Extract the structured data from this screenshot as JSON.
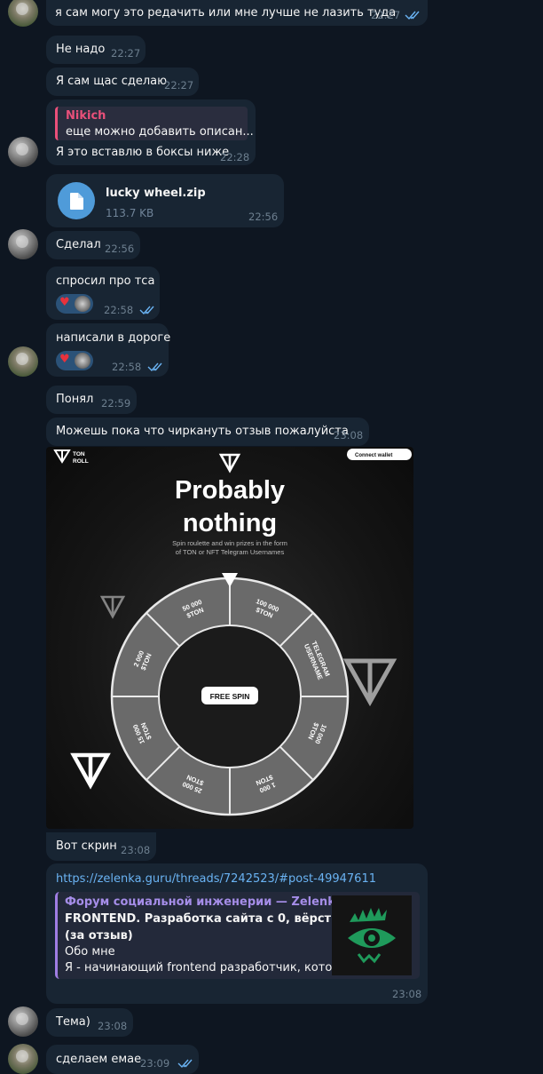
{
  "messages": [
    {
      "text": "я сам могу это редачить или мне лучше не лазить туда",
      "time": "22:27"
    },
    {
      "text": "Не надо",
      "time": "22:27"
    },
    {
      "text": "Я сам щас сделаю",
      "time": "22:27"
    },
    {
      "reply_name": "Nikich",
      "reply_text": "еще можно добавить описан...",
      "text": "Я это вставлю в боксы ниже",
      "time": "22:28"
    },
    {
      "file_name": "lucky wheel.zip",
      "file_size": "113.7 KB",
      "time": "22:56"
    },
    {
      "text": "Сделал",
      "time": "22:56"
    },
    {
      "text": "спросил про тса",
      "time": "22:58",
      "reaction": "♥"
    },
    {
      "text": "написали в дороге",
      "time": "22:58",
      "reaction": "♥"
    },
    {
      "text": "Понял",
      "time": "22:59"
    },
    {
      "text": "Можешь пока что чиркануть отзыв пожалуйста",
      "time": "23:08"
    },
    {
      "text": "Вот скрин",
      "time": "23:08"
    },
    {
      "link": "https://zelenka.guru/threads/7242523/#post-49947611",
      "preview_site": "Форум социальной инженерии — Zelenka....",
      "preview_title_1": "FRONTEND. Разработка сайта с 0, вёрстка.",
      "preview_title_2": "(за отзыв)",
      "preview_line_1": "Обо мне",
      "preview_line_2": "Я - начинающий frontend разработчик, кото...",
      "time": "23:08"
    },
    {
      "text": "Тема)",
      "time": "23:08"
    },
    {
      "text": "сделаем емае",
      "time": "23:09"
    }
  ],
  "screenshot": {
    "brand_line1": "TON",
    "brand_line2": "ROLL",
    "connect_label": "Connect wallet",
    "headline_1": "Probably",
    "headline_2": "nothing",
    "subtitle_1": "Spin roulette and win prizes in the form",
    "subtitle_2": "of TON or NFT Telegram Usernames",
    "center_button": "FREE SPIN",
    "sectors": [
      {
        "l1": "100 000",
        "l2": "$TON"
      },
      {
        "l1": "TELEGRAM",
        "l2": "USERNAME"
      },
      {
        "l1": "10 000",
        "l2": "$TON"
      },
      {
        "l1": "1 000",
        "l2": "$TON"
      },
      {
        "l1": "25 000",
        "l2": "$TON"
      },
      {
        "l1": "15 000",
        "l2": "$TON"
      },
      {
        "l1": "2 000",
        "l2": "$TON"
      },
      {
        "l1": "50 000",
        "l2": "$TON"
      }
    ]
  },
  "colors": {
    "background": "#0e1621",
    "bubble": "#182533",
    "accent": "#6ab3f3",
    "reply_accent": "#e9507a",
    "preview_accent": "#9f7de3"
  }
}
